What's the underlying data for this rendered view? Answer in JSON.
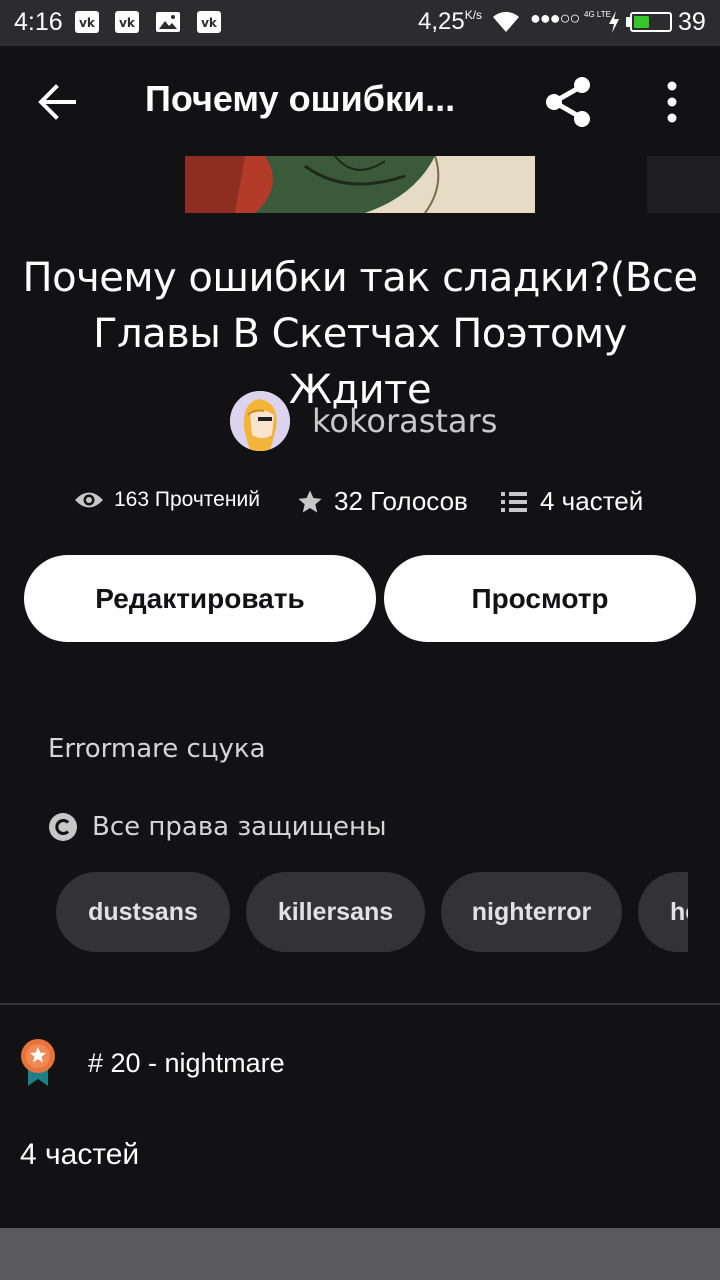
{
  "status_bar": {
    "time": "4:16",
    "app_icons": [
      "vk-icon",
      "vk-icon",
      "gallery-icon",
      "vk-icon"
    ],
    "speed": "4,25",
    "speed_unit": "K/s",
    "network": "4G LTE",
    "battery": "39",
    "battery_level": 0.39,
    "battery_color": "#35c62c"
  },
  "toolbar": {
    "title": "Почему ошибки..."
  },
  "story": {
    "title": "Почему ошибки так сладки?(Все Главы В Скетчах Поэтому Ждите",
    "author": "kokorastars",
    "stats": {
      "reads": "163 Прочтений",
      "votes": "32 Голосов",
      "parts": "4 частей"
    },
    "description": "Errormare сцука",
    "copyright": "Все права защищены"
  },
  "buttons": {
    "edit": "Редактировать",
    "view": "Просмотр"
  },
  "tags": [
    "dustsans",
    "killersans",
    "nighterror",
    "he"
  ],
  "rank": {
    "label": "# 20 - nightmare",
    "badge_color": "#e8733c"
  },
  "parts_heading": "4 частей"
}
